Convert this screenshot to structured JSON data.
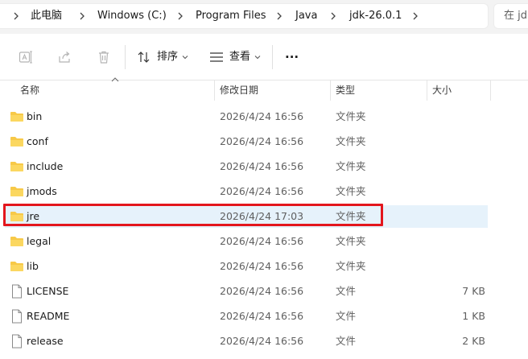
{
  "breadcrumb": [
    {
      "label": "此电脑"
    },
    {
      "label": "Windows (C:)"
    },
    {
      "label": "Program Files"
    },
    {
      "label": "Java"
    },
    {
      "label": "jdk-26.0.1"
    }
  ],
  "search": {
    "placeholder": "在 jd"
  },
  "toolbar": {
    "sort_label": "排序",
    "view_label": "查看",
    "more_label": "···"
  },
  "columns": {
    "name": "名称",
    "modified": "修改日期",
    "type": "类型",
    "size": "大小"
  },
  "files": [
    {
      "name": "bin",
      "modified": "2026/4/24 16:56",
      "type": "文件夹",
      "size": "",
      "kind": "folder"
    },
    {
      "name": "conf",
      "modified": "2026/4/24 16:56",
      "type": "文件夹",
      "size": "",
      "kind": "folder"
    },
    {
      "name": "include",
      "modified": "2026/4/24 16:56",
      "type": "文件夹",
      "size": "",
      "kind": "folder"
    },
    {
      "name": "jmods",
      "modified": "2026/4/24 16:56",
      "type": "文件夹",
      "size": "",
      "kind": "folder"
    },
    {
      "name": "jre",
      "modified": "2026/4/24 17:03",
      "type": "文件夹",
      "size": "",
      "kind": "folder",
      "selected": true
    },
    {
      "name": "legal",
      "modified": "2026/4/24 16:56",
      "type": "文件夹",
      "size": "",
      "kind": "folder"
    },
    {
      "name": "lib",
      "modified": "2026/4/24 16:56",
      "type": "文件夹",
      "size": "",
      "kind": "folder"
    },
    {
      "name": "LICENSE",
      "modified": "2026/4/24 16:56",
      "type": "文件",
      "size": "7 KB",
      "kind": "file"
    },
    {
      "name": "README",
      "modified": "2026/4/24 16:56",
      "type": "文件",
      "size": "1 KB",
      "kind": "file"
    },
    {
      "name": "release",
      "modified": "2026/4/24 16:56",
      "type": "文件",
      "size": "2 KB",
      "kind": "file"
    }
  ],
  "colors": {
    "folder": "#f7c948",
    "selected_row": "#e6f2fb",
    "highlight": "#e3161d"
  },
  "icons": {
    "toolbar": [
      "rename-icon",
      "share-icon",
      "delete-icon",
      "sort-icon",
      "view-icon",
      "more-icon"
    ],
    "folder": "folder-icon",
    "file": "document-icon"
  }
}
